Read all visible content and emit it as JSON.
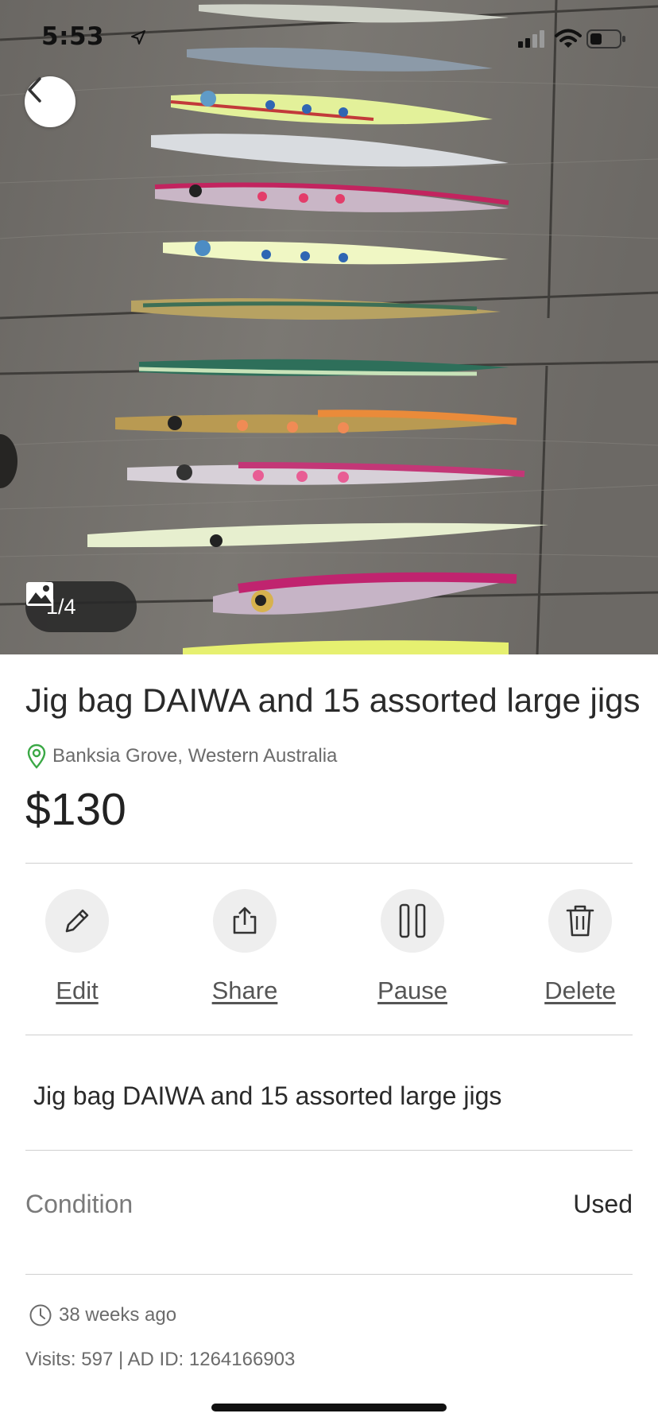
{
  "status_bar": {
    "time": "5:53"
  },
  "photo": {
    "counter": "1/4",
    "gallery_icon": "image-icon"
  },
  "listing": {
    "title": "Jig bag DAIWA and 15 assorted large jigs",
    "location": "Banksia Grove, Western Australia",
    "price": "$130",
    "description": "Jig bag DAIWA and 15 assorted large jigs",
    "condition_label": "Condition",
    "condition_value": "Used",
    "posted": "38 weeks ago",
    "stats": "Visits: 597 | AD ID: 1264166903"
  },
  "actions": [
    {
      "label": "Edit",
      "icon": "pencil-icon"
    },
    {
      "label": "Share",
      "icon": "share-icon"
    },
    {
      "label": "Pause",
      "icon": "pause-icon"
    },
    {
      "label": "Delete",
      "icon": "trash-icon"
    }
  ],
  "colors": {
    "location_pin": "#3aa845",
    "divider": "#cfcfcf",
    "action_bg": "#eeeeee"
  }
}
